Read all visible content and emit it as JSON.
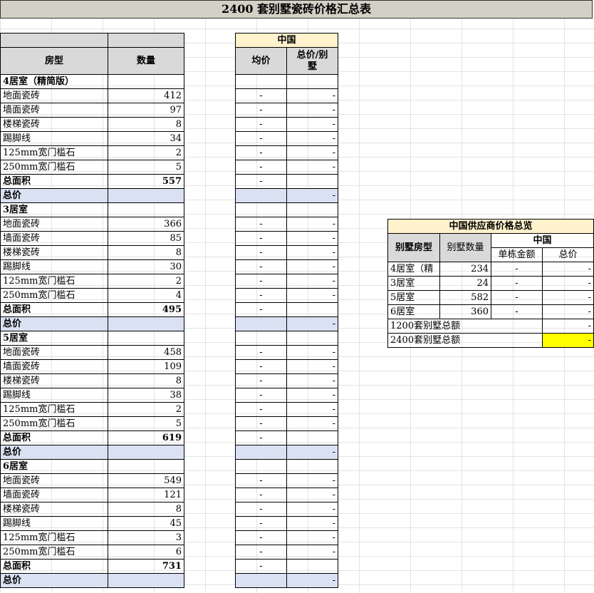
{
  "title": "2400 套别墅瓷砖价格汇总表",
  "headers": {
    "type": "房型",
    "qty": "数量",
    "china": "中国",
    "avg": "均价",
    "total_line1": "总价/别",
    "total_line2": "墅"
  },
  "dash": "-",
  "sections": [
    {
      "name": "4居室（精简版）",
      "items": [
        {
          "label": "地面瓷砖",
          "qty": "412"
        },
        {
          "label": "墙面瓷砖",
          "qty": "97"
        },
        {
          "label": "楼梯瓷砖",
          "qty": "8"
        },
        {
          "label": "踢脚线",
          "qty": "34"
        },
        {
          "label": "125mm宽门槛石",
          "qty": "2"
        },
        {
          "label": "250mm宽门槛石",
          "qty": "5"
        }
      ],
      "area_label": "总面积",
      "area": "557",
      "price_label": "总价"
    },
    {
      "name": "3居室",
      "items": [
        {
          "label": "地面瓷砖",
          "qty": "366"
        },
        {
          "label": "墙面瓷砖",
          "qty": "85"
        },
        {
          "label": "楼梯瓷砖",
          "qty": "8"
        },
        {
          "label": "踢脚线",
          "qty": "30"
        },
        {
          "label": "125mm宽门槛石",
          "qty": "2"
        },
        {
          "label": "250mm宽门槛石",
          "qty": "4"
        }
      ],
      "area_label": "总面积",
      "area": "495",
      "price_label": "总价"
    },
    {
      "name": "5居室",
      "items": [
        {
          "label": "地面瓷砖",
          "qty": "458"
        },
        {
          "label": "墙面瓷砖",
          "qty": "109"
        },
        {
          "label": "楼梯瓷砖",
          "qty": "8"
        },
        {
          "label": "踢脚线",
          "qty": "38"
        },
        {
          "label": "125mm宽门槛石",
          "qty": "2"
        },
        {
          "label": "250mm宽门槛石",
          "qty": "5"
        }
      ],
      "area_label": "总面积",
      "area": "619",
      "price_label": "总价"
    },
    {
      "name": "6居室",
      "items": [
        {
          "label": "地面瓷砖",
          "qty": "549"
        },
        {
          "label": "墙面瓷砖",
          "qty": "121"
        },
        {
          "label": "楼梯瓷砖",
          "qty": "8"
        },
        {
          "label": "踢脚线",
          "qty": "45"
        },
        {
          "label": "125mm宽门槛石",
          "qty": "3"
        },
        {
          "label": "250mm宽门槛石",
          "qty": "6"
        }
      ],
      "area_label": "总面积",
      "area": "731",
      "price_label": "总价"
    }
  ],
  "summary": {
    "title": "中国供应商价格总览",
    "col_type": "别墅房型",
    "col_count": "别墅数量",
    "china": "中国",
    "col_unit": "单栋金额",
    "col_total": "总价",
    "rows": [
      {
        "type": "4居室（精",
        "count": "234"
      },
      {
        "type": "3居室",
        "count": "24"
      },
      {
        "type": "5居室",
        "count": "582"
      },
      {
        "type": "6居室",
        "count": "360"
      }
    ],
    "total_1200": "1200套别墅总额",
    "total_2400": "2400套别墅总额"
  },
  "colors": {
    "title_bg": "#d3d0c5",
    "header_bg": "#d9d9d9",
    "china_bg": "#fff2cc",
    "subtotal_bg": "#d9e1f2",
    "highlight": "#ffff00"
  }
}
